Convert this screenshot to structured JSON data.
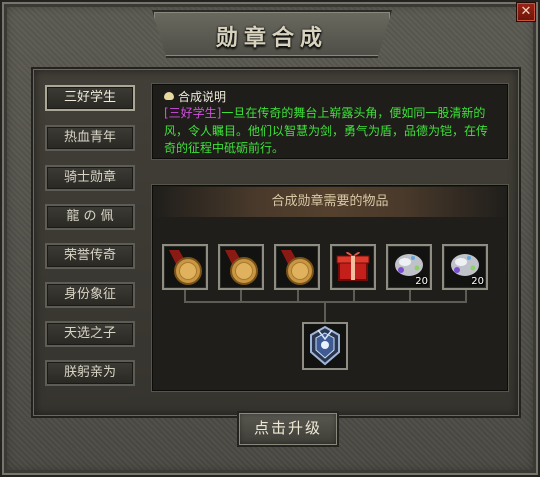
{
  "window": {
    "title": "勋章合成",
    "close_label": "✕"
  },
  "sidebar": {
    "items": [
      {
        "label": "三好学生",
        "active": true
      },
      {
        "label": "热血青年",
        "active": false
      },
      {
        "label": "骑士勋章",
        "active": false
      },
      {
        "label": "龍 の 佩",
        "active": false
      },
      {
        "label": "荣誉传奇",
        "active": false
      },
      {
        "label": "身份象征",
        "active": false
      },
      {
        "label": "天选之子",
        "active": false
      },
      {
        "label": "朕躬亲为",
        "active": false
      }
    ]
  },
  "description": {
    "title": "合成说明",
    "tag": "[三好学生]",
    "text": "一旦在传奇的舞台上崭露头角，便如同一股清新的风，令人瞩目。他们以智慧为剑，勇气为盾，品德为铠，在传奇的征程中砥砺前行。"
  },
  "materials": {
    "header": "合成勋章需要的物品",
    "items": [
      {
        "icon": "gold-medal-icon",
        "count": ""
      },
      {
        "icon": "gold-medal-icon",
        "count": ""
      },
      {
        "icon": "gold-medal-icon",
        "count": ""
      },
      {
        "icon": "red-gift-box-icon",
        "count": ""
      },
      {
        "icon": "crystal-ore-icon",
        "count": "20"
      },
      {
        "icon": "crystal-ore-icon",
        "count": "20"
      }
    ],
    "result_icon": "medal-result-icon"
  },
  "actions": {
    "upgrade_label": "点击升级"
  }
}
